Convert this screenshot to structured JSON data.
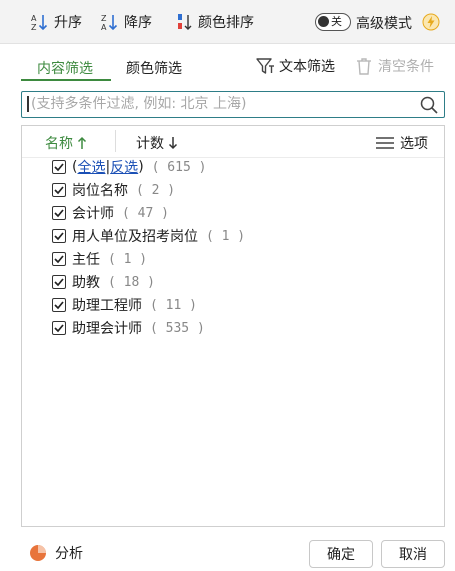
{
  "toolbar": {
    "sort_asc_label": "升序",
    "sort_desc_label": "降序",
    "color_sort_label": "颜色排序",
    "toggle_state": "关",
    "advanced_mode_label": "高级模式"
  },
  "tabs": {
    "content_filter": "内容筛选",
    "color_filter": "颜色筛选",
    "text_filter": "文本筛选",
    "clear_conditions": "清空条件"
  },
  "search": {
    "placeholder": "(支持多条件过滤, 例如: 北京 上海)"
  },
  "list": {
    "header": {
      "name_label": "名称",
      "count_label": "计数",
      "options_label": "选项"
    },
    "select_all": {
      "open": "(",
      "all_label": "全选",
      "sep": "|",
      "invert_label": "反选",
      "close": ")",
      "count": "( 615 )"
    },
    "items": [
      {
        "label": "岗位名称",
        "count": "( 2 )",
        "checked": true
      },
      {
        "label": "会计师",
        "count": "( 47 )",
        "checked": true
      },
      {
        "label": "用人单位及招考岗位",
        "count": "( 1 )",
        "checked": true
      },
      {
        "label": "主任",
        "count": "( 1 )",
        "checked": true
      },
      {
        "label": "助教",
        "count": "( 18 )",
        "checked": true
      },
      {
        "label": "助理工程师",
        "count": "( 11 )",
        "checked": true
      },
      {
        "label": "助理会计师",
        "count": "( 535 )",
        "checked": true
      }
    ]
  },
  "footer": {
    "analyze_label": "分析",
    "ok_label": "确定",
    "cancel_label": "取消"
  },
  "colors": {
    "accent_green": "#3d8a3f",
    "search_border": "#2e7d87",
    "pie_orange": "#e8743b"
  }
}
